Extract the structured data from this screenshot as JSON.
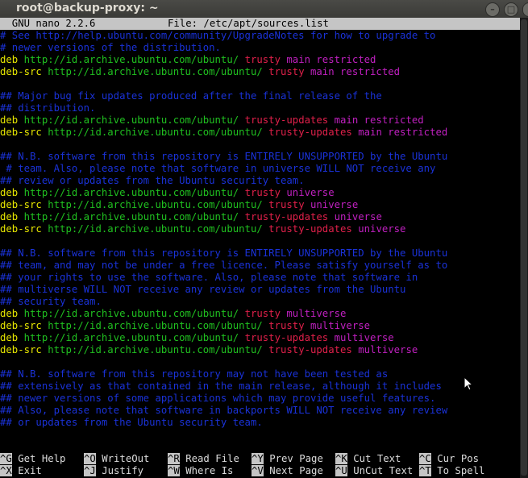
{
  "window": {
    "title": "root@backup-proxy: ~",
    "buttons": [
      "minimize",
      "maximize",
      "close"
    ]
  },
  "nano": {
    "version_label": "  GNU nano 2.2.6",
    "file_label": "File: /etc/apt/sources.list"
  },
  "lines": [
    [],
    [
      {
        "c": "comment",
        "t": "# See http://help.ubuntu.com/community/UpgradeNotes for how to upgrade to"
      }
    ],
    [
      {
        "c": "comment",
        "t": "# newer versions of the distribution."
      }
    ],
    [
      {
        "c": "type",
        "t": "deb "
      },
      {
        "c": "url",
        "t": "http://id.archive.ubuntu.com/ubuntu/ "
      },
      {
        "c": "suite",
        "t": "trusty "
      },
      {
        "c": "comp",
        "t": "main restricted"
      }
    ],
    [
      {
        "c": "type",
        "t": "deb-src "
      },
      {
        "c": "url",
        "t": "http://id.archive.ubuntu.com/ubuntu/ "
      },
      {
        "c": "suite",
        "t": "trusty "
      },
      {
        "c": "comp",
        "t": "main restricted"
      }
    ],
    [],
    [
      {
        "c": "comment",
        "t": "## Major bug fix updates produced after the final release of the"
      }
    ],
    [
      {
        "c": "comment",
        "t": "## distribution."
      }
    ],
    [
      {
        "c": "type",
        "t": "deb "
      },
      {
        "c": "url",
        "t": "http://id.archive.ubuntu.com/ubuntu/ "
      },
      {
        "c": "suite",
        "t": "trusty-updates "
      },
      {
        "c": "comp",
        "t": "main restricted"
      }
    ],
    [
      {
        "c": "type",
        "t": "deb-src "
      },
      {
        "c": "url",
        "t": "http://id.archive.ubuntu.com/ubuntu/ "
      },
      {
        "c": "suite",
        "t": "trusty-updates "
      },
      {
        "c": "comp",
        "t": "main restricted"
      }
    ],
    [],
    [
      {
        "c": "comment",
        "t": "## N.B. software from this repository is ENTIRELY UNSUPPORTED by the Ubuntu"
      }
    ],
    [
      {
        "c": "cursor",
        "t": "#"
      },
      {
        "c": "comment",
        "t": "# team. Also, please note that software in universe WILL NOT receive any"
      }
    ],
    [
      {
        "c": "comment",
        "t": "## review or updates from the Ubuntu security team."
      }
    ],
    [
      {
        "c": "type",
        "t": "deb "
      },
      {
        "c": "url",
        "t": "http://id.archive.ubuntu.com/ubuntu/ "
      },
      {
        "c": "suite",
        "t": "trusty "
      },
      {
        "c": "comp",
        "t": "universe"
      }
    ],
    [
      {
        "c": "type",
        "t": "deb-src "
      },
      {
        "c": "url",
        "t": "http://id.archive.ubuntu.com/ubuntu/ "
      },
      {
        "c": "suite",
        "t": "trusty "
      },
      {
        "c": "comp",
        "t": "universe"
      }
    ],
    [
      {
        "c": "type",
        "t": "deb "
      },
      {
        "c": "url",
        "t": "http://id.archive.ubuntu.com/ubuntu/ "
      },
      {
        "c": "suite",
        "t": "trusty-updates "
      },
      {
        "c": "comp",
        "t": "universe"
      }
    ],
    [
      {
        "c": "type",
        "t": "deb-src "
      },
      {
        "c": "url",
        "t": "http://id.archive.ubuntu.com/ubuntu/ "
      },
      {
        "c": "suite",
        "t": "trusty-updates "
      },
      {
        "c": "comp",
        "t": "universe"
      }
    ],
    [],
    [
      {
        "c": "comment",
        "t": "## N.B. software from this repository is ENTIRELY UNSUPPORTED by the Ubuntu"
      }
    ],
    [
      {
        "c": "comment",
        "t": "## team, and may not be under a free licence. Please satisfy yourself as to"
      }
    ],
    [
      {
        "c": "comment",
        "t": "## your rights to use the software. Also, please note that software in"
      }
    ],
    [
      {
        "c": "comment",
        "t": "## multiverse WILL NOT receive any review or updates from the Ubuntu"
      }
    ],
    [
      {
        "c": "comment",
        "t": "## security team."
      }
    ],
    [
      {
        "c": "type",
        "t": "deb "
      },
      {
        "c": "url",
        "t": "http://id.archive.ubuntu.com/ubuntu/ "
      },
      {
        "c": "suite",
        "t": "trusty "
      },
      {
        "c": "comp",
        "t": "multiverse"
      }
    ],
    [
      {
        "c": "type",
        "t": "deb-src "
      },
      {
        "c": "url",
        "t": "http://id.archive.ubuntu.com/ubuntu/ "
      },
      {
        "c": "suite",
        "t": "trusty "
      },
      {
        "c": "comp",
        "t": "multiverse"
      }
    ],
    [
      {
        "c": "type",
        "t": "deb "
      },
      {
        "c": "url",
        "t": "http://id.archive.ubuntu.com/ubuntu/ "
      },
      {
        "c": "suite",
        "t": "trusty-updates "
      },
      {
        "c": "comp",
        "t": "multiverse"
      }
    ],
    [
      {
        "c": "type",
        "t": "deb-src "
      },
      {
        "c": "url",
        "t": "http://id.archive.ubuntu.com/ubuntu/ "
      },
      {
        "c": "suite",
        "t": "trusty-updates "
      },
      {
        "c": "comp",
        "t": "multiverse"
      }
    ],
    [],
    [
      {
        "c": "comment",
        "t": "## N.B. software from this repository may not have been tested as"
      }
    ],
    [
      {
        "c": "comment",
        "t": "## extensively as that contained in the main release, although it includes"
      }
    ],
    [
      {
        "c": "comment",
        "t": "## newer versions of some applications which may provide useful features."
      }
    ],
    [
      {
        "c": "comment",
        "t": "## Also, please note that software in backports WILL NOT receive any review"
      }
    ],
    [
      {
        "c": "comment",
        "t": "## or updates from the Ubuntu security team."
      }
    ]
  ],
  "shortcuts": [
    [
      {
        "key": "^G",
        "label": " Get Help"
      },
      {
        "key": "^O",
        "label": " WriteOut"
      },
      {
        "key": "^R",
        "label": " Read File"
      },
      {
        "key": "^Y",
        "label": " Prev Page"
      },
      {
        "key": "^K",
        "label": " Cut Text"
      },
      {
        "key": "^C",
        "label": " Cur Pos"
      }
    ],
    [
      {
        "key": "^X",
        "label": " Exit"
      },
      {
        "key": "^J",
        "label": " Justify"
      },
      {
        "key": "^W",
        "label": " Where Is"
      },
      {
        "key": "^V",
        "label": " Next Page"
      },
      {
        "key": "^U",
        "label": " UnCut Text"
      },
      {
        "key": "^T",
        "label": " To Spell"
      }
    ]
  ],
  "colors": {
    "comment": "#1a32d8",
    "type": "#e6e600",
    "url": "#20c020",
    "suite": "#e0204a",
    "component": "#c020c0",
    "header_bg": "#c5c5c5"
  }
}
